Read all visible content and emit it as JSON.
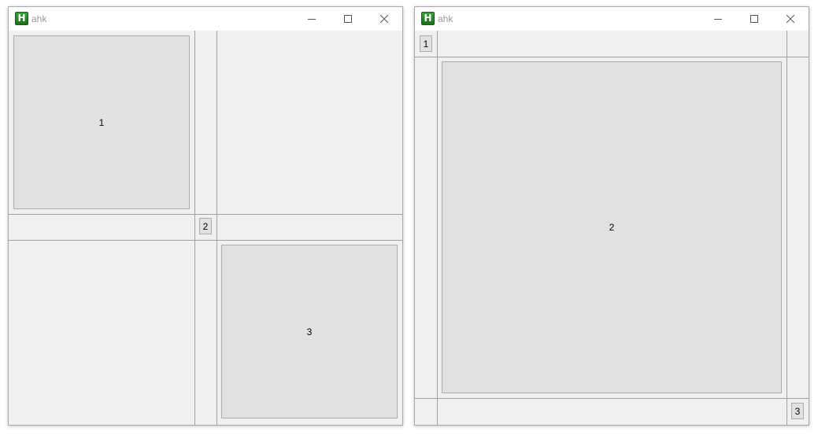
{
  "windows": [
    {
      "title": "ahk",
      "icon": "autohotkey-icon",
      "icon_letter": "H",
      "buttons": [
        "1",
        "2",
        "3"
      ]
    },
    {
      "title": "ahk",
      "icon": "autohotkey-icon",
      "icon_letter": "H",
      "buttons": [
        "1",
        "2",
        "3"
      ]
    }
  ],
  "colors": {
    "window_bg": "#f0f0f0",
    "button_face": "#e1e1e1",
    "separator": "#a0a0a0",
    "icon_green": "#2e8b2e"
  }
}
